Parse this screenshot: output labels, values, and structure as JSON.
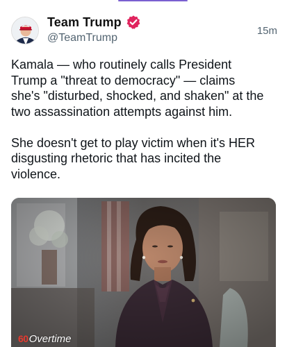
{
  "colors": {
    "accent_line": "#7a5fd0",
    "verified_badge": "#e0245e",
    "logo_red": "#e53a2f",
    "text_primary": "#0f1419",
    "text_secondary": "#536471"
  },
  "post": {
    "author": {
      "display_name": "Team Trump",
      "handle": "@TeamTrump",
      "verified_icon": "verified-badge-icon",
      "avatar_icon": "profile-avatar"
    },
    "timestamp": "15m",
    "body": "Kamala — who routinely calls President\nTrump a \"threat to democracy\" — claims\nshe's \"disturbed, shocked, and shaken\" at the\ntwo assassination attempts against him.\n\nShe doesn't get to play victim when it's HER\ndisgusting rhetoric that has incited the\nviolence.",
    "media": {
      "watermark_number": "60",
      "watermark_word": "Overtime"
    }
  }
}
